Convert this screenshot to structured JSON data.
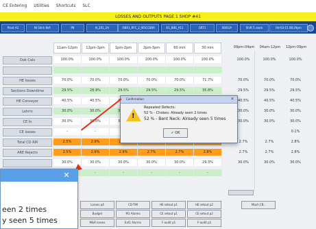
{
  "menubar": {
    "items": [
      "CE Entering",
      "Utilities",
      "Shortcuts",
      "SLC"
    ]
  },
  "titlebar": {
    "title": "LOSSES AND OUTPUTS  PAGE 1  SHOP #41"
  },
  "infobar": {
    "chips": [
      "Plant A1",
      "Ni Sitch Ref:",
      "P8",
      "N_201_2A",
      "OBX1_RFC_2_W1CC800",
      "R1_BRE_A11",
      "GRT1",
      "0001/A",
      "Shift 5 room",
      "Rd-03-15 08:29pm"
    ]
  },
  "table": {
    "columns": [
      "11am-12pm",
      "12pm-1pm",
      "1pm-2pm",
      "2pm-3pm",
      "60 min",
      "30 min"
    ],
    "extra_headers": [
      "09pm-04am",
      "04am-12pm",
      "12pm-09pm"
    ],
    "rows": [
      {
        "label": "Dok Cals",
        "cells": [
          "100.0%",
          "100.0%",
          "100.0%",
          "100.0%",
          "100.0%",
          "100.0%"
        ],
        "extras": [
          "100.0%",
          "100.0%",
          "100.0%"
        ],
        "color": "white"
      },
      {
        "label": "",
        "cells": [
          "",
          "",
          "",
          "",
          "",
          ""
        ],
        "extras": [
          "",
          "",
          ""
        ],
        "color": "green"
      },
      {
        "label": "HE losses",
        "cells": [
          "70.0%",
          "70.0%",
          "70.0%",
          "70.0%",
          "70.0%",
          "71.7%"
        ],
        "extras": [
          "70.0%",
          "70.0%",
          "70.0%"
        ],
        "color": "white"
      },
      {
        "label": "Sections Downtime",
        "cells": [
          "29.5%",
          "26.9%",
          "29.5%",
          "29.5%",
          "29.5%",
          "35.8%"
        ],
        "extras": [
          "29.5%",
          "29.5%",
          "29.5%"
        ],
        "color": "green"
      },
      {
        "label": "HE Conveyor",
        "cells": [
          "40.5%",
          "40.5%",
          "40.5%",
          "",
          "",
          "40.5%"
        ],
        "extras": [
          "40.5%",
          "40.5%",
          "40.5%"
        ],
        "color": "white"
      },
      {
        "label": "Lehrin",
        "cells": [
          "30.0%",
          "30.0%",
          "30.0%",
          "30.0%",
          "30.0%",
          "30.0%"
        ],
        "extras": [
          "30.0%",
          "30.0%",
          "30.0%"
        ],
        "color": "green"
      },
      {
        "label": "CE In",
        "cells": [
          "30.0%",
          "30.0%",
          "30.0%",
          "30.0%",
          "30.0%",
          "30.0%"
        ],
        "extras": [
          "30.0%",
          "30.0%",
          "30.0%"
        ],
        "color": "white"
      },
      {
        "label": "CE losses",
        "cells": [
          "-",
          "-",
          "-",
          "-",
          "-",
          "-"
        ],
        "extras": [
          "",
          "",
          "0.1%"
        ],
        "color": "white"
      },
      {
        "label": "Total CD RM",
        "cells": [
          "2.5%",
          "2.9%",
          "2.9%",
          "2.7%",
          "2.7%",
          "2.8%"
        ],
        "extras": [
          "2.7%",
          "2.7%",
          "2.8%"
        ],
        "color": "orange"
      },
      {
        "label": "ARE Rejects",
        "cells": [
          "2.5%",
          "2.9%",
          "2.9%",
          "2.7%",
          "2.7%",
          "2.8%"
        ],
        "extras": [
          "2.7%",
          "2.7%",
          "2.8%"
        ],
        "color": "orange"
      },
      {
        "label": "",
        "cells": [
          "30.0%",
          "30.0%",
          "30.0%",
          "30.0%",
          "30.0%",
          "29.3%"
        ],
        "extras": [
          "30.0%",
          "30.0%",
          "30.0%"
        ],
        "color": "white"
      },
      {
        "label": "",
        "cells": [
          "-",
          "-",
          "-",
          "-",
          "-",
          "-"
        ],
        "extras": [
          "",
          "",
          ""
        ],
        "color": "green"
      }
    ]
  },
  "dialog": {
    "title": "Confirmation",
    "line1": "Repeated Defects:",
    "line2": "52 % - Chokes: Already seen 2 times",
    "line3": "52 % - Bent Neck: Already seen 5 times",
    "ok_label": "OK"
  },
  "zoom": {
    "line1": "een 2 times",
    "line2": "y seen 5 times"
  },
  "buttons": [
    "Losses p4",
    "CD-TIM",
    "HE setout p1",
    "HE setout p2",
    "Mach CB..",
    "Budget",
    "M1 Alarms",
    "CE setout p1",
    "CE setout p2",
    "M&R losses",
    "Ext1 Alarms",
    "F-audit p1",
    "F-audit p2"
  ]
}
